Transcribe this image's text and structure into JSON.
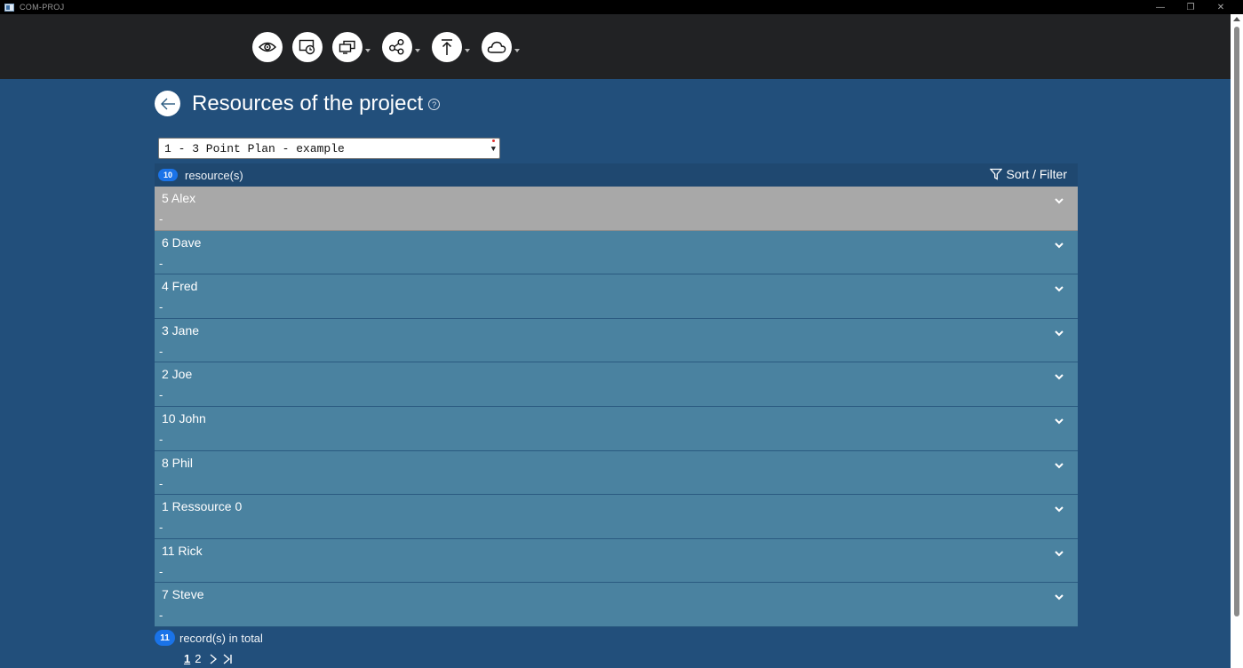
{
  "window": {
    "title": "COM-PROJ"
  },
  "toolbar": {
    "buttons": [
      {
        "icon": "eye-icon",
        "has_dropdown": false
      },
      {
        "icon": "screen-clock-icon",
        "has_dropdown": false
      },
      {
        "icon": "monitors-icon",
        "has_dropdown": true
      },
      {
        "icon": "share-icon",
        "has_dropdown": true
      },
      {
        "icon": "upload-icon",
        "has_dropdown": true
      },
      {
        "icon": "cloud-icon",
        "has_dropdown": true
      }
    ]
  },
  "header": {
    "title": "Resources of the project",
    "help": "?"
  },
  "project_select": {
    "value": "1 - 3 Point Plan - example"
  },
  "list_header": {
    "count": "10",
    "label": "resource(s)",
    "sort_filter_label": "Sort / Filter"
  },
  "resources": [
    {
      "name": "5 Alex",
      "sub": "-",
      "selected": true
    },
    {
      "name": "6 Dave",
      "sub": "-"
    },
    {
      "name": "4 Fred",
      "sub": "-"
    },
    {
      "name": "3 Jane",
      "sub": "-"
    },
    {
      "name": "2 Joe",
      "sub": "-"
    },
    {
      "name": "10 John",
      "sub": "-"
    },
    {
      "name": "8 Phil",
      "sub": "-"
    },
    {
      "name": "1 Ressource 0",
      "sub": "-"
    },
    {
      "name": "11 Rick",
      "sub": "-"
    },
    {
      "name": "7 Steve",
      "sub": "-"
    }
  ],
  "footer": {
    "total_count": "11",
    "total_label": "record(s) in total",
    "pages": [
      "1",
      "2"
    ],
    "current_page": "1"
  },
  "colors": {
    "background": "#224f7b",
    "toolbar": "#212224",
    "row": "#4a82a0",
    "row_selected": "#a8a8a8",
    "badge": "#1a73e8"
  }
}
